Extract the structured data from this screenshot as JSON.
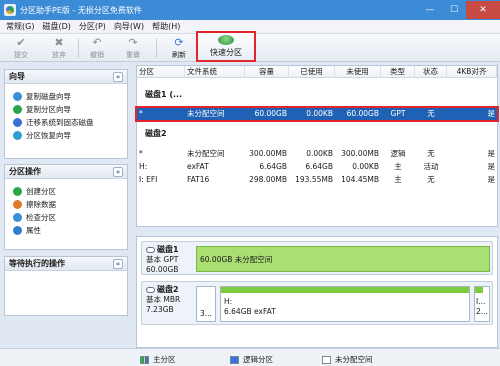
{
  "window": {
    "title": "分区助手PE版 - 无损分区免费软件",
    "minimize": "—",
    "maximize": "☐",
    "close": "✕"
  },
  "menu": [
    "常规(G)",
    "磁盘(D)",
    "分区(P)",
    "向导(W)",
    "帮助(H)"
  ],
  "toolbar": {
    "buttons": [
      {
        "label": "提交",
        "icon": "check-icon",
        "glyph": "✔"
      },
      {
        "label": "放弃",
        "icon": "discard-icon",
        "glyph": "✖"
      },
      {
        "label": "撤销",
        "icon": "undo-icon",
        "glyph": "↶"
      },
      {
        "label": "重做",
        "icon": "redo-icon",
        "glyph": "↷"
      },
      {
        "label": "刷新",
        "icon": "refresh-icon",
        "glyph": "⟳"
      }
    ],
    "quick_partition": "快速分区"
  },
  "sidebar": {
    "wizard": {
      "title": "向导",
      "items": [
        "复制磁盘向导",
        "复制分区向导",
        "迁移系统到固态磁盘",
        "分区恢复向导"
      ]
    },
    "partition_ops": {
      "title": "分区操作",
      "items": [
        "创建分区",
        "擦除数据",
        "检查分区",
        "属性"
      ]
    },
    "pending": {
      "title": "等待执行的操作"
    },
    "collapse": "«"
  },
  "grid": {
    "columns": [
      "分区",
      "文件系统",
      "容量",
      "已使用",
      "未使用",
      "类型",
      "状态",
      "4KB对齐"
    ],
    "disk1_label": "磁盘1 (...",
    "disk1_rows": [
      {
        "part": "*",
        "fs": "未分配空间",
        "cap": "60.00GB",
        "used": "0.00KB",
        "free": "60.00GB",
        "type": "GPT",
        "status": "无",
        "align": "是"
      }
    ],
    "disk2_label": "磁盘2",
    "disk2_rows": [
      {
        "part": "*",
        "fs": "未分配空间",
        "cap": "300.00MB",
        "used": "0.00KB",
        "free": "300.00MB",
        "type": "逻辑",
        "status": "无",
        "align": "是"
      },
      {
        "part": "H:",
        "fs": "exFAT",
        "cap": "6.64GB",
        "used": "6.64GB",
        "free": "0.00KB",
        "type": "主",
        "status": "活动",
        "align": "是"
      },
      {
        "part": "I: EFI",
        "fs": "FAT16",
        "cap": "298.00MB",
        "used": "193.55MB",
        "free": "104.45MB",
        "type": "主",
        "status": "无",
        "align": "是"
      }
    ],
    "dots": "....."
  },
  "diskmap": {
    "disk1": {
      "name": "磁盘1",
      "type": "基本 GPT",
      "size": "60.00GB",
      "seg_label": "60.00GB 未分配空间"
    },
    "disk2": {
      "name": "磁盘2",
      "type": "基本 MBR",
      "size": "7.23GB",
      "seg1": "3...",
      "seg2_name": "H:",
      "seg2_label": "6.64GB exFAT",
      "seg3_name": "I...",
      "seg3_label": "2..."
    }
  },
  "legend": [
    "主分区",
    "逻辑分区",
    "未分配空间"
  ],
  "colors": {
    "primary": "#2aa54a",
    "logical": "#3a6fd6",
    "unallocated": "#ffffff",
    "selected": "#1f62b5",
    "highlight": "#e0262b"
  }
}
